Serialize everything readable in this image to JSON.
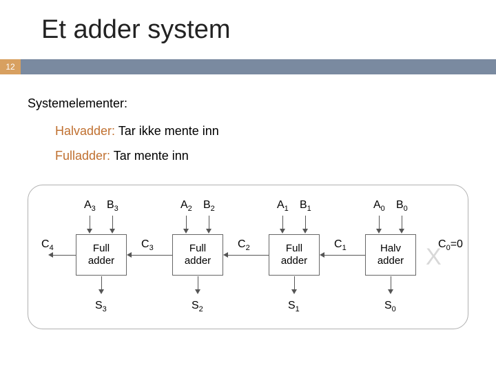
{
  "slide": {
    "title": "Et adder system",
    "page_number": "12",
    "subtitle": "Systemelementer:",
    "bullets": {
      "halvadder": {
        "term": "Halvadder:",
        "desc": " Tar ikke mente inn"
      },
      "fulladder": {
        "term": "Fulladder:",
        "desc": " Tar mente inn"
      }
    }
  },
  "diagram": {
    "adders": [
      {
        "kind": "Full",
        "line1": "Full",
        "line2": "adder",
        "A": "A",
        "Asub": "3",
        "B": "B",
        "Bsub": "3",
        "S": "S",
        "Ssub": "3",
        "Cout": "C",
        "CoutSub": "4"
      },
      {
        "kind": "Full",
        "line1": "Full",
        "line2": "adder",
        "A": "A",
        "Asub": "2",
        "B": "B",
        "Bsub": "2",
        "S": "S",
        "Ssub": "2",
        "Cout": "C",
        "CoutSub": "3"
      },
      {
        "kind": "Full",
        "line1": "Full",
        "line2": "adder",
        "A": "A",
        "Asub": "1",
        "B": "B",
        "Bsub": "1",
        "S": "S",
        "Ssub": "1",
        "Cout": "C",
        "CoutSub": "2"
      },
      {
        "kind": "Halv",
        "line1": "Halv",
        "line2": "adder",
        "A": "A",
        "Asub": "0",
        "B": "B",
        "Bsub": "0",
        "S": "S",
        "Ssub": "0",
        "Cout": "C",
        "CoutSub": "1"
      }
    ],
    "cin_label": {
      "text": "C",
      "sub": "0",
      "suffix": "=0"
    }
  }
}
